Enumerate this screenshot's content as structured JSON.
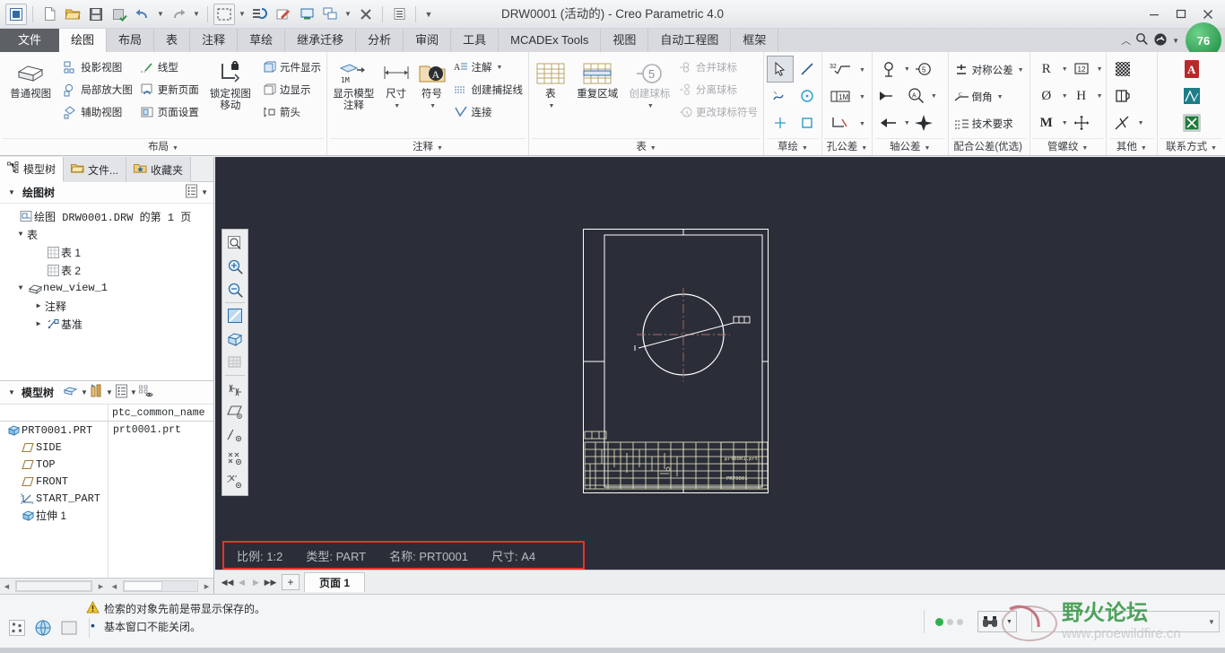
{
  "window": {
    "title": "DRW0001 (活动的) - Creo Parametric 4.0",
    "minimize": "—",
    "maximize": "▢",
    "close": "✕"
  },
  "quick_access": {
    "items": [
      {
        "name": "app-menu-icon",
        "glyph": "▣"
      },
      {
        "name": "new-icon",
        "glyph": "📄"
      },
      {
        "name": "open-icon",
        "glyph": "📂"
      },
      {
        "name": "save-icon",
        "glyph": "💾"
      },
      {
        "name": "save-as-icon",
        "glyph": "🗂"
      },
      {
        "name": "undo-icon",
        "glyph": "↶"
      },
      {
        "name": "redo-icon",
        "glyph": "↷"
      },
      {
        "name": "select-box-icon",
        "glyph": "⬚"
      },
      {
        "name": "regenerate-icon",
        "glyph": "⚙"
      },
      {
        "name": "sketch-edit-icon",
        "glyph": "✎"
      },
      {
        "name": "window-icon",
        "glyph": "🖥"
      },
      {
        "name": "tile-windows-icon",
        "glyph": "❐"
      },
      {
        "name": "close-window-icon",
        "glyph": "⊠"
      },
      {
        "name": "list-icon",
        "glyph": "☰"
      },
      {
        "name": "customize-qat-icon",
        "glyph": "▾"
      }
    ]
  },
  "ribbon_tabs": [
    {
      "label": "文件",
      "kind": "file"
    },
    {
      "label": "绘图",
      "kind": "active"
    },
    {
      "label": "布局",
      "kind": "normal"
    },
    {
      "label": "表",
      "kind": "normal"
    },
    {
      "label": "注释",
      "kind": "normal"
    },
    {
      "label": "草绘",
      "kind": "normal"
    },
    {
      "label": "继承迁移",
      "kind": "normal"
    },
    {
      "label": "分析",
      "kind": "normal"
    },
    {
      "label": "审阅",
      "kind": "normal"
    },
    {
      "label": "工具",
      "kind": "normal"
    },
    {
      "label": "MCADEx Tools",
      "kind": "normal"
    },
    {
      "label": "视图",
      "kind": "normal"
    },
    {
      "label": "自动工程图",
      "kind": "normal"
    },
    {
      "label": "框架",
      "kind": "normal"
    }
  ],
  "ribbon": {
    "groups": [
      {
        "title": "布局",
        "big": [
          {
            "label_line1": "普通视图",
            "label_line2": "",
            "icon": "cube-icon"
          }
        ],
        "col1": [
          {
            "label": "投影视图",
            "icon": "projection-view-icon"
          },
          {
            "label": "局部放大图",
            "icon": "detailed-view-icon"
          },
          {
            "label": "辅助视图",
            "icon": "auxiliary-view-icon"
          }
        ],
        "col2": [
          {
            "label": "线型",
            "icon": "line-style-icon"
          },
          {
            "label": "更新页面",
            "icon": "update-sheet-icon"
          },
          {
            "label": "页面设置",
            "icon": "page-setup-icon"
          }
        ],
        "big2": [
          {
            "label_line1": "锁定视图",
            "label_line2": "移动",
            "icon": "lock-view-icon"
          }
        ],
        "col3": [
          {
            "label": "元件显示",
            "icon": "component-display-icon"
          },
          {
            "label": "边显示",
            "icon": "edge-display-icon"
          },
          {
            "label": "箭头",
            "icon": "arrows-icon"
          }
        ]
      },
      {
        "title": "注释",
        "big": [
          {
            "label_line1": "显示模型",
            "label_line2": "注释",
            "icon": "show-model-annotations-icon"
          },
          {
            "label_line1": "尺寸",
            "label_line2": "▾",
            "icon": "dimension-icon"
          },
          {
            "label_line1": "符号",
            "label_line2": "▾",
            "icon": "symbol-icon"
          }
        ],
        "col1": [
          {
            "label": "注解",
            "icon": "note-icon",
            "dropdown": true
          },
          {
            "label": "创建捕捉线",
            "icon": "snap-line-icon"
          },
          {
            "label": "连接",
            "icon": "attach-icon"
          }
        ]
      },
      {
        "title": "表",
        "big": [
          {
            "label_line1": "表",
            "label_line2": "▾",
            "icon": "table-icon"
          },
          {
            "label_line1": "重复区域",
            "label_line2": "",
            "icon": "repeat-region-icon"
          },
          {
            "label_line1": "创建球标",
            "label_line2": "▾",
            "icon": "create-balloon-icon",
            "disabled": true
          }
        ],
        "col1": [
          {
            "label": "合并球标",
            "icon": "merge-balloons-icon",
            "disabled": true
          },
          {
            "label": "分离球标",
            "icon": "split-balloons-icon",
            "disabled": true
          },
          {
            "label": "更改球标符号",
            "icon": "change-balloon-symbol-icon",
            "disabled": true
          }
        ]
      },
      {
        "title": "草绘",
        "icons": [
          {
            "name": "select-arrow-icon",
            "glyph": "↖",
            "selected": true
          },
          {
            "name": "line-icon",
            "glyph": "╲"
          },
          {
            "name": "spline-icon",
            "glyph": "〜"
          },
          {
            "name": "circle-center-icon",
            "glyph": "◎"
          },
          {
            "name": "point-icon",
            "glyph": "✛"
          },
          {
            "name": "rectangle-icon",
            "glyph": "▢"
          }
        ]
      },
      {
        "title": "孔公差",
        "icons": [
          {
            "name": "roughness-32-icon",
            "glyph": "32√"
          },
          {
            "name": "datum-1m-icon",
            "glyph": "⊞1M"
          },
          {
            "name": "chamfer-tol-icon",
            "glyph": "◹"
          }
        ]
      },
      {
        "title": "轴公差",
        "icons": [
          {
            "name": "axis-tolerance-icon",
            "glyph": "⊕"
          },
          {
            "name": "balloon-5-icon",
            "glyph": "⑤"
          },
          {
            "name": "arrow-tag-icon",
            "glyph": "➤"
          },
          {
            "name": "magnifier-tol-icon",
            "glyph": "🔍"
          },
          {
            "name": "left-arrow-icon",
            "glyph": "←"
          },
          {
            "name": "center-mark-icon",
            "glyph": "✥"
          }
        ]
      },
      {
        "title": "配合公差(优选)",
        "col1": [
          {
            "label": "对称公差",
            "icon": "symmetric-tolerance-icon",
            "dropdown": true
          },
          {
            "label": "倒角",
            "icon": "chamfer-icon",
            "dropdown": true
          },
          {
            "label": "技术要求",
            "icon": "technical-requirements-icon"
          }
        ]
      },
      {
        "title": "管螺纹",
        "icons": [
          {
            "name": "radius-icon",
            "glyph": "R"
          },
          {
            "name": "boxed-12-icon",
            "glyph": "⑫"
          },
          {
            "name": "diameter-icon",
            "glyph": "Ø"
          },
          {
            "name": "h-tolerance-icon",
            "glyph": "H"
          },
          {
            "name": "m-thread-icon",
            "glyph": "M"
          },
          {
            "name": "move-cross-icon",
            "glyph": "✥"
          }
        ]
      },
      {
        "title": "其他",
        "icons": [
          {
            "name": "hatch-pattern-icon",
            "glyph": "▨"
          },
          {
            "name": "section-symbol-icon",
            "glyph": "◫"
          },
          {
            "name": "break-line-icon",
            "glyph": "⤬"
          }
        ]
      },
      {
        "title": "联系方式",
        "icons": [
          {
            "name": "pdf-export-icon",
            "glyph": "A"
          },
          {
            "name": "autocad-export-icon",
            "glyph": "A"
          },
          {
            "name": "excel-export-icon",
            "glyph": "X"
          }
        ]
      }
    ]
  },
  "left_panel": {
    "tabs": [
      {
        "label": "模型树",
        "icon": "model-tree-icon",
        "active": true
      },
      {
        "label": "文件...",
        "icon": "folder-icon",
        "active": false
      },
      {
        "label": "收藏夹",
        "icon": "favorites-icon",
        "active": false
      }
    ],
    "drawing_tree": {
      "header": "绘图树",
      "settings_icon": "settings-list-icon",
      "caret_icon": "chevron-down-icon",
      "nodes": [
        {
          "label": "绘图 DRW0001.DRW 的第 1 页",
          "indent": 0,
          "twisty": "",
          "icon": "sheet-icon",
          "mono": true
        },
        {
          "label": "表",
          "indent": 0,
          "twisty": "▼",
          "icon": "",
          "mono": false
        },
        {
          "label": "表 1",
          "indent": 2,
          "twisty": "",
          "icon": "table-node-icon",
          "mono": false
        },
        {
          "label": "表 2",
          "indent": 2,
          "twisty": "",
          "icon": "table-node-icon",
          "mono": false
        },
        {
          "label": "new_view_1",
          "indent": 0,
          "twisty": "▼",
          "icon": "view-icon",
          "mono": true
        },
        {
          "label": "注释",
          "indent": 1,
          "twisty": "▶",
          "icon": "",
          "mono": false
        },
        {
          "label": "基准",
          "indent": 1,
          "twisty": "▶",
          "icon": "datum-icon",
          "mono": false
        }
      ]
    },
    "model_tree": {
      "header": "模型树",
      "toolbar_icons": [
        "filter-icon",
        "chevron-down-icon",
        "tools-icon",
        "chevron-down-icon",
        "settings-list-icon",
        "chevron-down-icon",
        "show-hide-icon"
      ],
      "column_header": "ptc_common_name",
      "rows": [
        {
          "label": "PRT0001.PRT",
          "value": "prt0001.prt",
          "indent": 0,
          "icon": "part-icon"
        },
        {
          "label": "SIDE",
          "value": "",
          "indent": 1,
          "icon": "plane-icon"
        },
        {
          "label": "TOP",
          "value": "",
          "indent": 1,
          "icon": "plane-icon"
        },
        {
          "label": "FRONT",
          "value": "",
          "indent": 1,
          "icon": "plane-icon"
        },
        {
          "label": "START_PART",
          "value": "",
          "indent": 1,
          "icon": "csys-icon"
        },
        {
          "label": "拉伸 1",
          "value": "",
          "indent": 1,
          "icon": "extrude-icon"
        }
      ]
    }
  },
  "graphics_toolbar": [
    {
      "name": "zoom-fit-icon",
      "glyph": "⌕"
    },
    {
      "name": "zoom-in-icon",
      "glyph": "⊕"
    },
    {
      "name": "zoom-out-icon",
      "glyph": "⊖"
    },
    {
      "name": "repaint-icon",
      "glyph": "◪"
    },
    {
      "name": "display-style-icon",
      "glyph": "▣"
    },
    {
      "name": "grid-display-icon",
      "glyph": "▦"
    },
    {
      "name": "datum-display-icon",
      "glyph": "✳"
    },
    {
      "name": "plane-display-icon",
      "glyph": "▱"
    },
    {
      "name": "axis-display-icon",
      "glyph": "∕"
    },
    {
      "name": "point-display-icon",
      "glyph": "✕"
    },
    {
      "name": "csys-display-icon",
      "glyph": "⊹"
    }
  ],
  "drawing_status": {
    "items": [
      {
        "label": "比例:",
        "value": "1:2"
      },
      {
        "label": "类型:",
        "value": "PART"
      },
      {
        "label": "名称:",
        "value": "PRT0001"
      },
      {
        "label": "尺寸:",
        "value": "A4"
      }
    ],
    "highlight_color": "#e8322b"
  },
  "title_block": {
    "part_name": "prt0001.prt",
    "drawing_no": "PRT0001"
  },
  "page_bar": {
    "nav_first": "◀◀",
    "nav_prev": "◀",
    "nav_next": "▶",
    "nav_last": "▶▶",
    "add": "+",
    "pages": [
      {
        "label": "页面 1",
        "active": true
      }
    ]
  },
  "messages": {
    "buttons": [
      {
        "name": "selection-filter-icon",
        "glyph": "⠿"
      },
      {
        "name": "web-browser-icon",
        "glyph": "🌐"
      },
      {
        "name": "blank-window-icon",
        "glyph": "▢"
      }
    ],
    "lines": [
      {
        "icon": "warning-icon",
        "text": "检索的对象先前是带显示保存的。"
      },
      {
        "icon": "bullet-icon",
        "text": "基本窗口不能关闭。"
      }
    ]
  },
  "status_right": {
    "dots": [
      "#2db24a",
      "#c9ccd0",
      "#c9ccd0"
    ],
    "find_icon": "binoculars-icon",
    "find_caret": "▾",
    "selection_caret": "▾"
  },
  "watermark": {
    "title": "野火论坛",
    "url": "www.proewildfire.cn"
  },
  "colors": {
    "graphics_bg": "#2b2e38",
    "drawing_line": "#ffffff",
    "title_block_line": "#f2f0c8",
    "centerline": "#b06a6a",
    "accent_red": "#e8322b",
    "ribbon_bg": "#fbfbfc"
  }
}
